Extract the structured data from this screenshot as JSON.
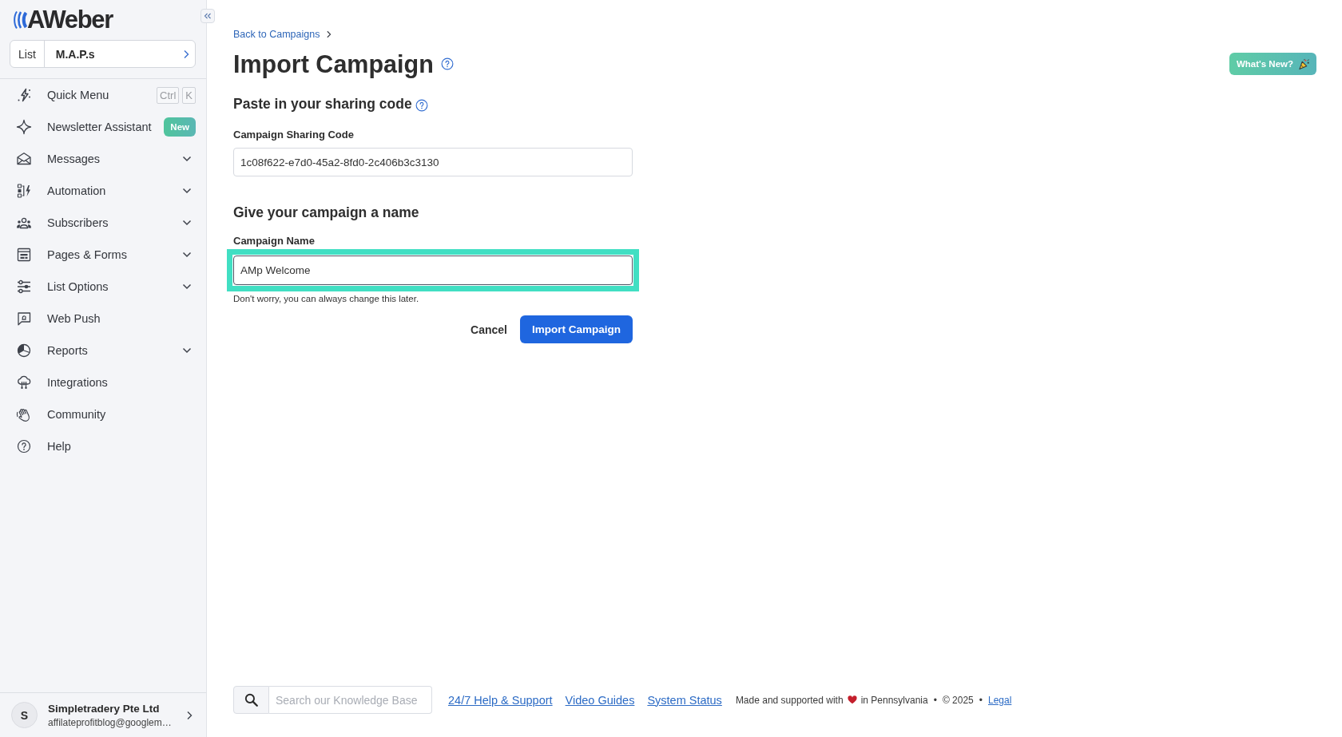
{
  "sidebar": {
    "logo": {
      "wordmark": "AWeber"
    },
    "list_selector": {
      "label": "List",
      "value": "M.A.P.s"
    },
    "items": [
      {
        "label": "Quick Menu",
        "shortcut": [
          "Ctrl",
          "K"
        ]
      },
      {
        "label": "Newsletter Assistant",
        "badge": "New"
      },
      {
        "label": "Messages",
        "expanded": false
      },
      {
        "label": "Automation",
        "expanded": false
      },
      {
        "label": "Subscribers",
        "expanded": false
      },
      {
        "label": "Pages & Forms",
        "expanded": false
      },
      {
        "label": "List Options",
        "expanded": false
      },
      {
        "label": "Web Push"
      },
      {
        "label": "Reports",
        "expanded": false
      },
      {
        "label": "Integrations"
      },
      {
        "label": "Community"
      },
      {
        "label": "Help"
      }
    ],
    "account": {
      "initial": "S",
      "name": "Simpletradery Pte Ltd",
      "email": "affilateprofitblog@googlem…"
    }
  },
  "header": {
    "breadcrumb": "Back to Campaigns",
    "title": "Import Campaign",
    "whats_new_button": "What's New?"
  },
  "form": {
    "sections": [
      {
        "heading": "Paste in your sharing code",
        "has_help": true,
        "field": {
          "label": "Campaign Sharing Code",
          "value": "1c08f622-e7d0-45a2-8fd0-2c406b3c3130",
          "focused": false,
          "highlighted": false
        }
      },
      {
        "heading": "Give your campaign a name",
        "has_help": false,
        "field": {
          "label": "Campaign Name",
          "value": "AMp Welcome",
          "hint": "Don't worry, you can always change this later.",
          "focused": true,
          "highlighted": true
        }
      }
    ],
    "cancel_button": "Cancel",
    "submit_button": "Import Campaign"
  },
  "footer": {
    "search": {
      "placeholder": "Search our Knowledge Base"
    },
    "links": [
      "24/7 Help & Support",
      "Video Guides",
      "System Status"
    ],
    "credit": {
      "made_with": "Made and supported with",
      "location": "in Pennsylvania",
      "separator_1": "•",
      "copyright": "© 2025",
      "separator_2": "•"
    },
    "legal_link": "Legal"
  }
}
